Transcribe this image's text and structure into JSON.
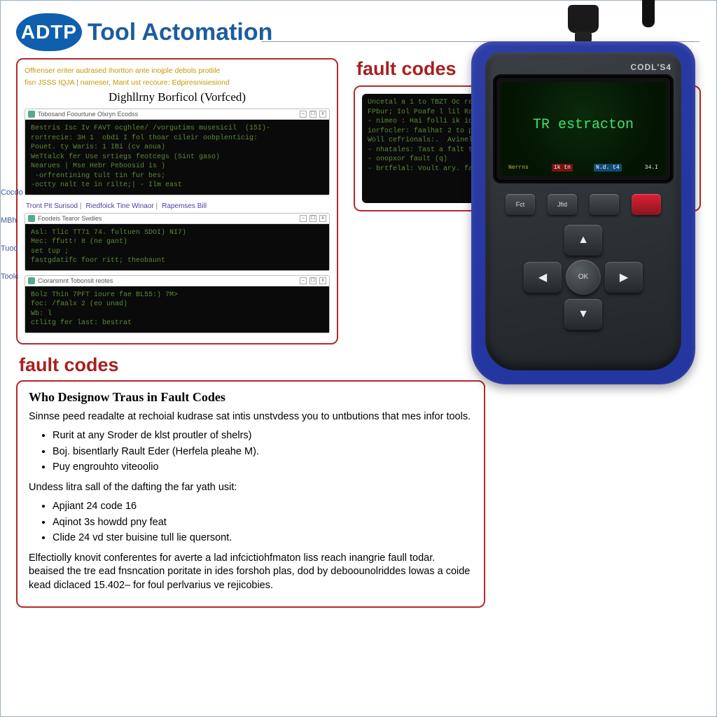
{
  "header": {
    "logo": "ADTP",
    "title": "Tool Actomation"
  },
  "panel1": {
    "top_line1": "Offrenser eriter audrased ihortton ante inojple debols protlile",
    "top_line2": "fisn JSSS IQJA | nameser, Mant ust recoure; Edpiresnisiesiond",
    "subtitle": "Dighllrny Borficol (Vorfced)",
    "term1_title": "Tobosand Foourtune Olxryn Ecodss",
    "term1_body": "Bestris Isc Iv FAVT ocghlee/ /vorgutims musesicil  (15I)-\nrortrecie: 3H 1  obdi I fol thoar cileir oobplenticig:\nPouet. ty Waris: 1 IBi (cv aoua)\nWeTtalck fer Use srtiegs feotcegs (Sint gaso)\nNearues | Mse Hebr Peboosid is )\n -orfrentining tult tin fur bes;\n-octty nalt te in rilte;| - Ilm east",
    "tabs": [
      "Tront Pit Surisod",
      "Riedfoick Tine Winaor",
      "Rapemses Bill"
    ],
    "term2_title": "Foodeis Tearor Swdies",
    "term2_body": "Asl: Tlic TT71 74. fultuen SDOI) NI7)\nMec: ffutt! 8 (ne gant)\nset tup ;\nfastgdatifc foor ritt; theobaunt",
    "term3_title": "Ciorarsmnt Tobonsit reotes",
    "term3_body": "Bolz Thin 7PFT ioure fae BL55:) 7M>\nfoc: /faalx 2 (eo unad)\nWb: l\nctlitg fer last: bestrat"
  },
  "side_labels": {
    "a": "Cocdo",
    "b": "MBh",
    "c": "Tuod",
    "d": "Toolc"
  },
  "right": {
    "heading": "fault codes",
    "term_body": "Uncetal a 1 to TBZT Oc retio 4 fooler aopcettib9) /135 U/1\nFPbur; Iol Poafe l lil Rafa spokselffatero plier aojere:\n- nimeo : Hai folli ik idlitle | sriolol gpeanbe\niorfocler: faalhat 2 to pexg:\nWoll cefrionals:.  Avinelel ). (stcll gonebe )\n- nhatales: Tast a falt to oup;\n- onopxor fault (q)\n- brtfelal: Voult ary. fallio); Uonstktip-"
  },
  "section2": {
    "heading": "fault codes",
    "title": "Who Designow Traus in Fault Codes",
    "para1": "Sinnse peed readalte at rechoial kudrase sat intis unstvdess you to untbutions that mes infor tools.",
    "list1": [
      "Rurit at any Sroder de klst proutler of shelrs)",
      "Boj. bisentlarly Rault Eder (Herfela pleahe M).",
      "Puy engrouhto viteoolio"
    ],
    "para2": "Undess litra sall of the dafting the far yath usit:",
    "list2": [
      "Apjiant 24 code 16",
      "Aqinot 3s howdd pny feat",
      "Clide 24 vd ster buisine tull lie quersont."
    ],
    "para3": "Elfectiolly knovit conferentes for averte a lad infcictiohfmaton liss reach inangrie faull todar. beaised the tre ead fnsncation poritate in ides forshoh plas, dod by deboounolriddes lowas a coide kead diclaced 15.402– for foul perlvarius ve rejicobies."
  },
  "device": {
    "brand": "CODL'S4",
    "screen_main": "TR estracton",
    "screen_label": "Nerrns",
    "bottom_tags": [
      "1k tn",
      "N.d. t4",
      "34.I"
    ],
    "btn1": "Fct",
    "btn2": "Jfid",
    "ok": "OK"
  }
}
